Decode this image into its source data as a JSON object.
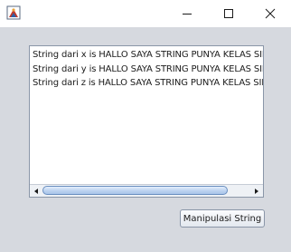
{
  "window": {
    "title": "",
    "controls": {
      "minimize_icon": "minimize-icon",
      "maximize_icon": "maximize-icon",
      "close_icon": "close-icon"
    }
  },
  "text_area": {
    "lines": [
      "String dari x is HALLO SAYA STRING PUNYA KELAS SINGLETON",
      "String dari y is HALLO SAYA STRING PUNYA KELAS SINGLETON",
      "String dari z is HALLO SAYA STRING PUNYA KELAS SINGLETON"
    ]
  },
  "button": {
    "label": "Manipulasi String"
  },
  "colors": {
    "titlebar": "#ffffff",
    "background": "#d6d9df",
    "text": "#1b1b1b",
    "scroll_thumb": "#bcd2f0"
  }
}
